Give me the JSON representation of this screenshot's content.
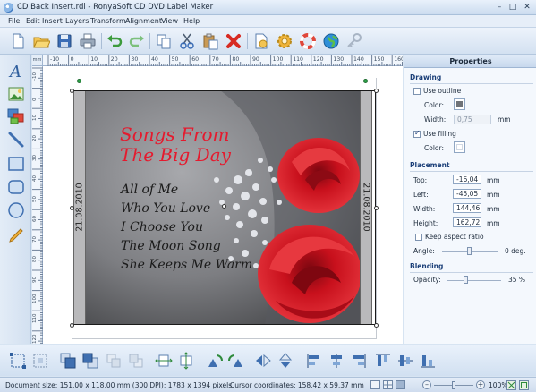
{
  "window": {
    "title": "CD Back Insert.rdl - RonyaSoft CD DVD Label Maker",
    "minimize_glyph": "–",
    "maximize_glyph": "□",
    "close_glyph": "✕"
  },
  "menu": [
    "File",
    "Edit",
    "Insert",
    "Layers",
    "Transform",
    "Alignment",
    "View",
    "Help"
  ],
  "toolbar": {
    "buttons": [
      "new-document-icon",
      "open-folder-icon",
      "save-icon",
      "print-icon",
      "undo-icon",
      "redo-icon",
      "copy-icon",
      "cut-icon",
      "paste-icon",
      "delete-icon",
      "document-settings-icon",
      "gear-icon",
      "lifebuoy-icon",
      "globe-icon",
      "key-icon"
    ]
  },
  "left_tools": [
    "text-tool-icon",
    "image-tool-icon",
    "picture-tool-icon",
    "line-tool-icon",
    "rectangle-tool-icon",
    "rounded-rectangle-tool-icon",
    "ellipse-tool-icon",
    "pencil-tool-icon"
  ],
  "ruler": {
    "top_labels": [
      "-10",
      "0",
      "10",
      "20",
      "30",
      "40",
      "50",
      "60",
      "70",
      "80",
      "90",
      "100",
      "110",
      "120",
      "130",
      "140",
      "150",
      "160"
    ],
    "left_labels": [
      "-10",
      "0",
      "10",
      "20",
      "30",
      "40",
      "50",
      "60",
      "70",
      "80",
      "90",
      "100",
      "110",
      "120"
    ],
    "unit": "mm"
  },
  "canvas": {
    "spine_left_text": "21.08.2010",
    "spine_right_text": "21.08.2010",
    "title_lines": [
      "Songs From",
      "The Big Day"
    ],
    "tracks": [
      "All of Me",
      "Who You Love",
      "I Choose You",
      "The Moon Song",
      "She Keeps Me Warm"
    ]
  },
  "properties": {
    "header": "Properties",
    "drawing": {
      "title": "Drawing",
      "use_outline_label": "Use outline",
      "use_outline_checked": false,
      "outline_color_label": "Color:",
      "outline_color": "#6f7378",
      "outline_width_label": "Width:",
      "outline_width": "0,75",
      "outline_width_unit": "mm",
      "use_filling_label": "Use filling",
      "use_filling_checked": true,
      "fill_color_label": "Color:",
      "fill_color": "#ffffff"
    },
    "placement": {
      "title": "Placement",
      "top_label": "Top:",
      "top_value": "-16,04",
      "left_label": "Left:",
      "left_value": "-45,05",
      "width_label": "Width:",
      "width_value": "144,46",
      "height_label": "Height:",
      "height_value": "162,72",
      "unit": "mm",
      "keep_aspect_label": "Keep aspect ratio",
      "keep_aspect_checked": false,
      "angle_label": "Angle:",
      "angle_value": "0 deg."
    },
    "blending": {
      "title": "Blending",
      "opacity_label": "Opacity:",
      "opacity_value": "35 %",
      "opacity_fraction": 0.35
    }
  },
  "bottom_toolbar": {
    "buttons": [
      "select-all-icon",
      "select-group-icon",
      "bring-to-front-icon",
      "send-to-back-icon",
      "bring-forward-icon",
      "send-backward-icon",
      "fit-width-icon",
      "fit-height-icon",
      "rotate-left-icon",
      "rotate-right-icon",
      "flip-horizontal-icon",
      "flip-vertical-icon",
      "align-left-icon",
      "align-center-icon",
      "align-right-icon",
      "align-top-icon",
      "align-middle-icon",
      "align-bottom-icon"
    ]
  },
  "status": {
    "document_size": "Document size: 151,00 x 118,00 mm (300 DPI); 1783 x 1394 pixels",
    "cursor": "Cursor coordinates: 158,42 x 59,37 mm",
    "zoom": "100%",
    "zoom_fraction": 0.5
  },
  "colors": {
    "accent": "#1b3f78",
    "title_text": "#e51a2e",
    "rose": "#c8101c",
    "spine": "#b9b9bb"
  }
}
